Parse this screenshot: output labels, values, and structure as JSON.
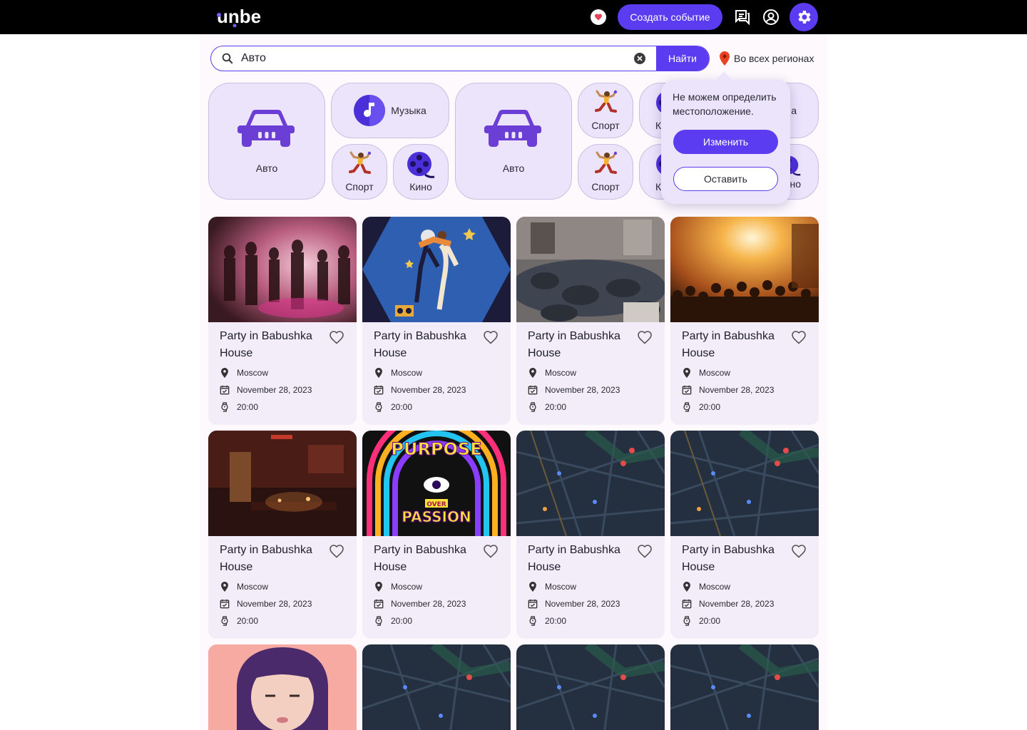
{
  "header": {
    "logo_text": "unbe",
    "create_event_label": "Создать событие"
  },
  "search": {
    "value": "Авто",
    "submit_label": "Найти",
    "region_label": "Во всех регионах"
  },
  "categories": [
    {
      "label": "Авто",
      "icon": "car-icon"
    },
    {
      "label": "Музыка",
      "icon": "music-note-icon"
    },
    {
      "label": "Спорт",
      "icon": "dancer-icon"
    },
    {
      "label": "Кино",
      "icon": "film-reel-icon"
    },
    {
      "label": "Авто",
      "icon": "car-icon"
    },
    {
      "label": "Спорт",
      "icon": "dancer-icon"
    },
    {
      "label": "Спорт",
      "icon": "dancer-icon"
    },
    {
      "label": "К",
      "icon": "film-reel-icon"
    },
    {
      "label": "К",
      "icon": "film-reel-icon"
    },
    {
      "label": "а",
      "icon": "music-note-icon"
    },
    {
      "label": "но",
      "icon": "film-reel-icon"
    }
  ],
  "location_popup": {
    "message": "Не можем определить местоположение.",
    "change_label": "Изменить",
    "keep_label": "Оставить"
  },
  "events": [
    {
      "title": "Party in Babushka House",
      "city": "Moscow",
      "date": "November 28, 2023",
      "time": "20:00",
      "image": "club-crowd"
    },
    {
      "title": "Party in Babushka House",
      "city": "Moscow",
      "date": "November 28, 2023",
      "time": "20:00",
      "image": "dancing-couple-illustration"
    },
    {
      "title": "Party in Babushka House",
      "city": "Moscow",
      "date": "November 28, 2023",
      "time": "20:00",
      "image": "house-party"
    },
    {
      "title": "Party in Babushka House",
      "city": "Moscow",
      "date": "November 28, 2023",
      "time": "20:00",
      "image": "concert-crowd"
    },
    {
      "title": "Party in Babushka House",
      "city": "Moscow",
      "date": "November 28, 2023",
      "time": "20:00",
      "image": "dark-bar-interior"
    },
    {
      "title": "Party in Babushka House",
      "city": "Moscow",
      "date": "November 28, 2023",
      "time": "20:00",
      "image": "purpose-over-passion-poster"
    },
    {
      "title": "Party in Babushka House",
      "city": "Moscow",
      "date": "November 28, 2023",
      "time": "20:00",
      "image": "dark-map"
    },
    {
      "title": "Party in Babushka House",
      "city": "Moscow",
      "date": "November 28, 2023",
      "time": "20:00",
      "image": "dark-map"
    }
  ],
  "poster_text": {
    "line1": "PURPOSE",
    "line2": "OVER",
    "line3": "PASSION"
  },
  "colors": {
    "accent": "#5b3cf0",
    "card_bg": "#f3edfa",
    "category_bg": "#ebe4fb",
    "topbar": "#000000"
  }
}
